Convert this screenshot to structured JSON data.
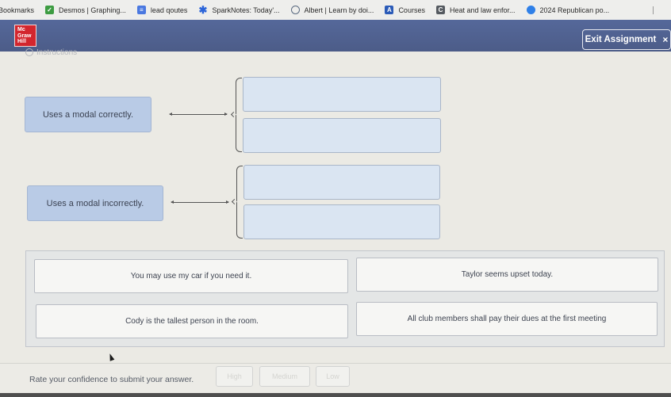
{
  "bookmarks": {
    "items": [
      {
        "label": "Bookmarks",
        "icon": null
      },
      {
        "label": "Desmos | Graphing...",
        "icon": "desmos-icon"
      },
      {
        "label": "lead qoutes",
        "icon": "doc-icon"
      },
      {
        "label": "SparkNotes: Today'...",
        "icon": "sparknotes-icon"
      },
      {
        "label": "Albert | Learn by doi...",
        "icon": "albert-icon"
      },
      {
        "label": "Courses",
        "icon": "courses-icon"
      },
      {
        "label": "Heat and law enfor...",
        "icon": "heat-icon"
      },
      {
        "label": "2024 Republican po...",
        "icon": "republican-icon"
      }
    ]
  },
  "header": {
    "logo": [
      "Mc",
      "Graw",
      "Hill"
    ],
    "exit_label": "Exit Assignment",
    "exit_icon": "×",
    "brand_color": "#d3262e",
    "bar_color": "#51628f"
  },
  "instructions_label": "Instructions",
  "categories": [
    {
      "label": "Uses a modal correctly."
    },
    {
      "label": "Uses a modal incorrectly."
    }
  ],
  "answer_bank": [
    {
      "label": "You may use my car if you need it."
    },
    {
      "label": "Taylor seems upset today."
    },
    {
      "label": "Cody is the tallest person in the room."
    },
    {
      "label": "All club members shall pay their dues at the first meeting"
    }
  ],
  "footer": {
    "rate_label": "Rate your confidence to submit your answer.",
    "buttons": [
      "High",
      "Medium",
      "Low"
    ]
  }
}
